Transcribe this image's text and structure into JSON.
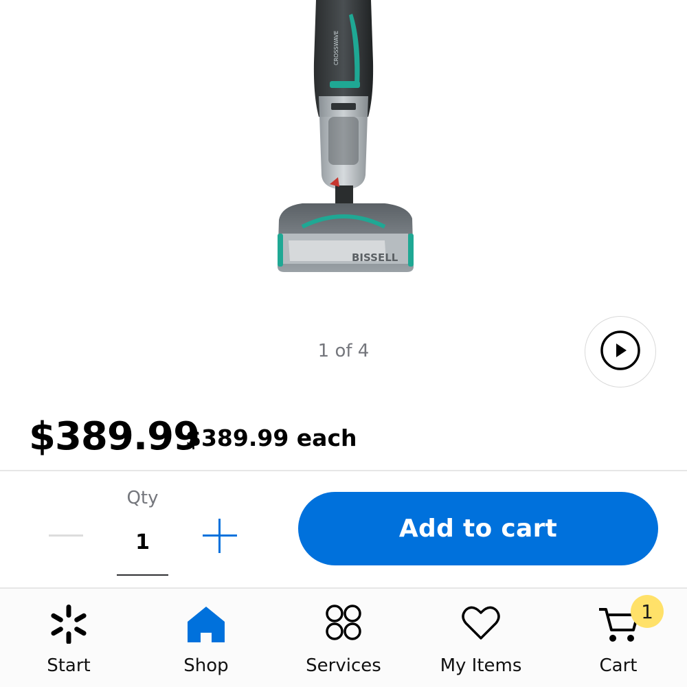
{
  "product": {
    "image_icon": "cordless-wet-dry-vacuum-image",
    "image_brand_text": "BISSELL",
    "image_counter": "1 of 4",
    "video_icon": "play-icon"
  },
  "pricing": {
    "price": "$389.99",
    "unit_price": "$389.99 each"
  },
  "quantity": {
    "label": "Qty",
    "value": "1",
    "decrement_icon": "minus-icon",
    "increment_icon": "plus-icon"
  },
  "actions": {
    "add_to_cart_label": "Add to cart"
  },
  "tabbar": {
    "items": [
      {
        "label": "Start",
        "icon": "spark-icon"
      },
      {
        "label": "Shop",
        "icon": "store-icon"
      },
      {
        "label": "Services",
        "icon": "services-grid-icon"
      },
      {
        "label": "My Items",
        "icon": "heart-icon"
      },
      {
        "label": "Cart",
        "icon": "cart-icon"
      }
    ],
    "cart_badge_count": "1"
  },
  "colors": {
    "accent_blue": "#0071dc",
    "badge_yellow": "#ffe169",
    "product_teal": "#1fa894",
    "muted_text": "#74767c"
  }
}
